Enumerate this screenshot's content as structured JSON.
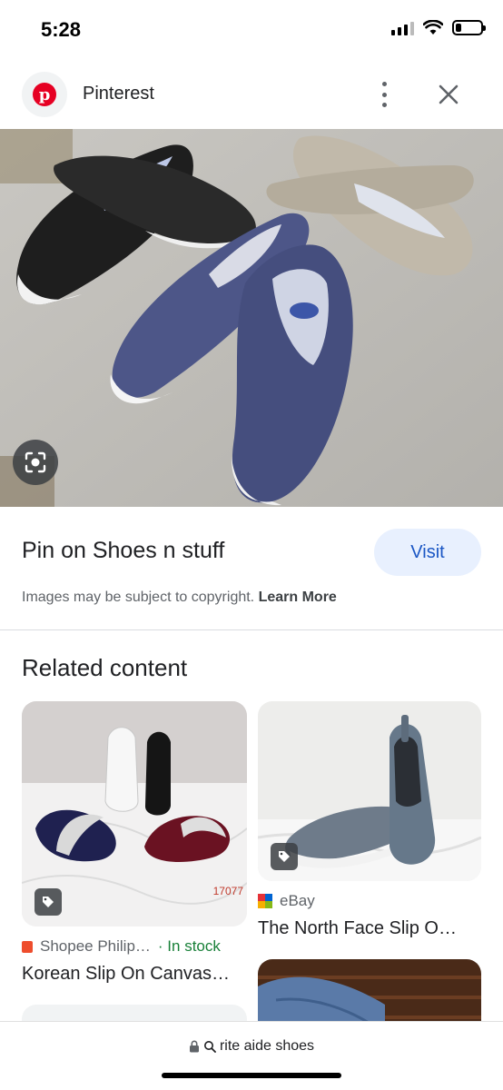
{
  "status": {
    "time": "5:28"
  },
  "source": {
    "name": "Pinterest",
    "logo_letter": "p",
    "icon": "pinterest-logo-icon"
  },
  "main": {
    "title": "Pin on Shoes n stuff",
    "visit_label": "Visit",
    "copyright_text": "Images may be subject to copyright.",
    "learn_more": "Learn More"
  },
  "related": {
    "heading": "Related content",
    "cards": [
      {
        "source": "Shopee Philip…",
        "availability": "· In stock",
        "title": "Korean Slip On Canvas…",
        "image_label": "17077"
      },
      {
        "source": "eBay",
        "title": "The North Face Slip O…"
      }
    ]
  },
  "bottom": {
    "url_text": "rite aide shoes"
  },
  "colors": {
    "accent": "#1a56c4",
    "visit_bg": "#e8f0fe",
    "in_stock": "#188038",
    "pinterest": "#e60023"
  }
}
